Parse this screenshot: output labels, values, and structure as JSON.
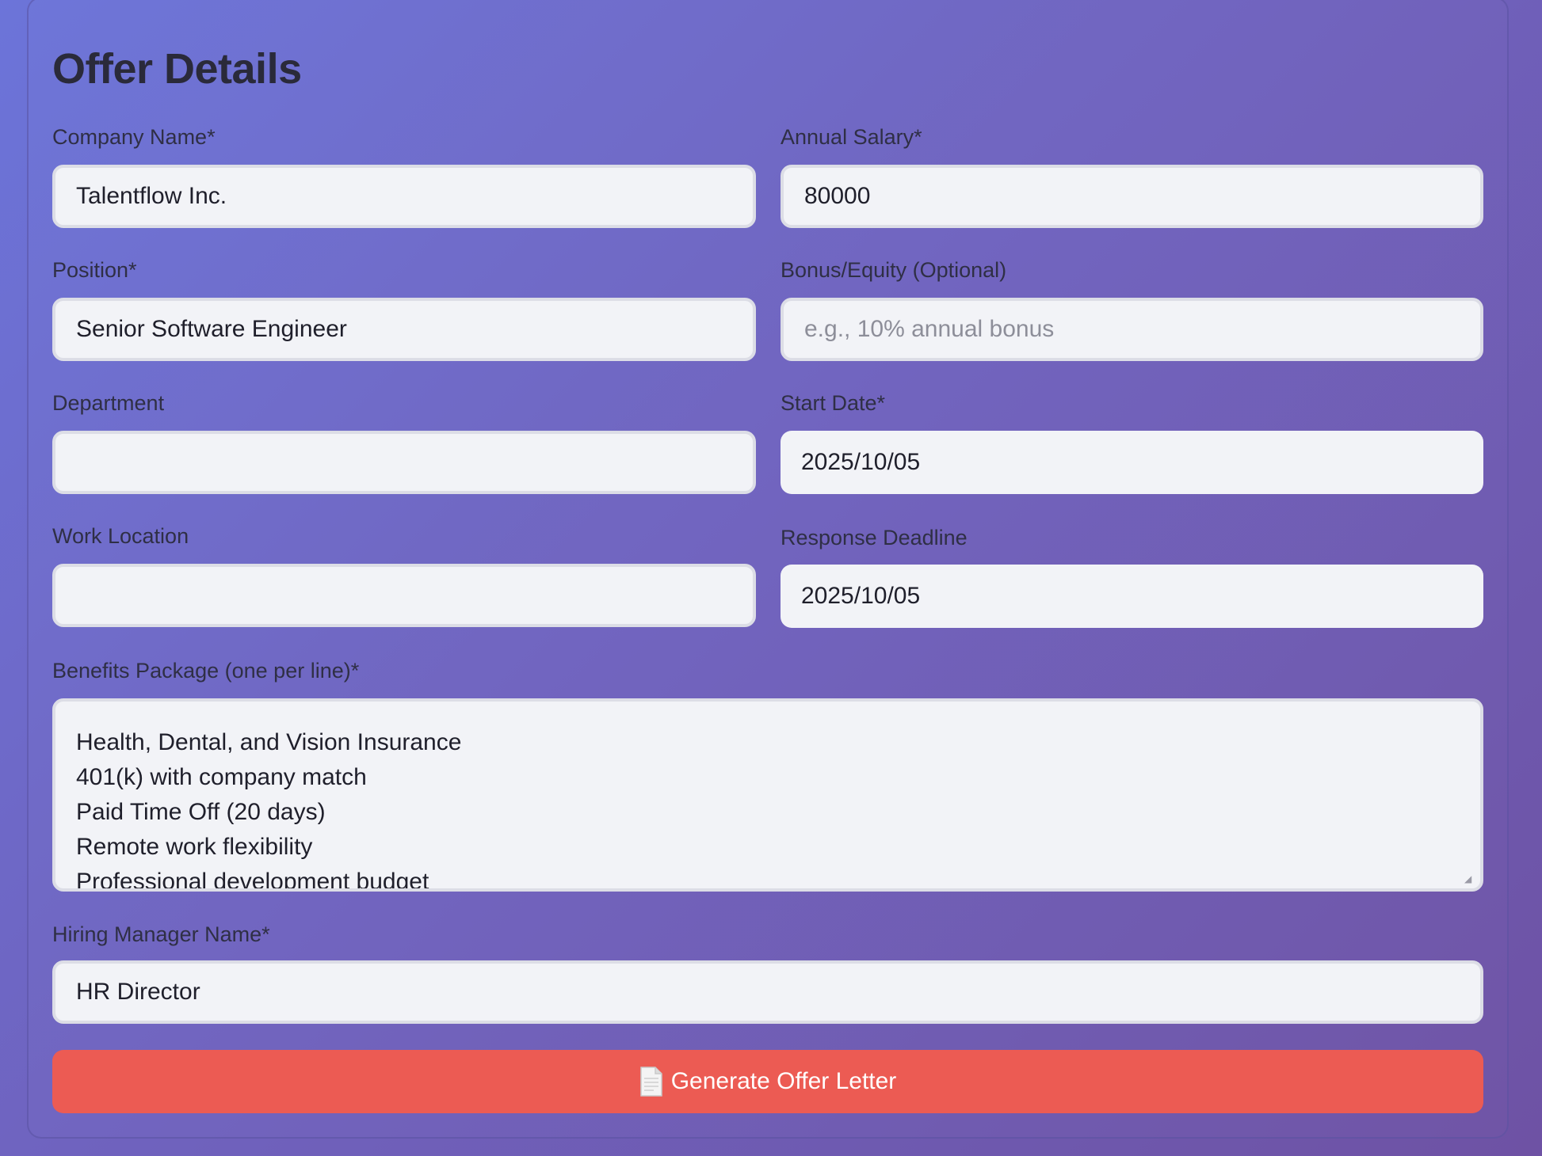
{
  "form": {
    "title": "Offer Details",
    "company": {
      "label": "Company Name*",
      "value": "Talentflow Inc."
    },
    "salary": {
      "label": "Annual Salary*",
      "value": "80000"
    },
    "position": {
      "label": "Position*",
      "value": "Senior Software Engineer"
    },
    "bonus": {
      "label": "Bonus/Equity (Optional)",
      "value": "",
      "placeholder": "e.g., 10% annual bonus"
    },
    "department": {
      "label": "Department",
      "value": ""
    },
    "start_date": {
      "label": "Start Date*",
      "value": "2025/10/05"
    },
    "work_location": {
      "label": "Work Location",
      "value": ""
    },
    "response_deadline": {
      "label": "Response Deadline",
      "value": "2025/10/05"
    },
    "benefits": {
      "label": "Benefits Package (one per line)*",
      "lines": [
        "Health, Dental, and Vision Insurance",
        "401(k) with company match",
        "Paid Time Off (20 days)",
        "Remote work flexibility",
        "Professional development budget"
      ]
    },
    "hiring_manager": {
      "label": "Hiring Manager Name*",
      "value": "HR Director"
    },
    "submit": {
      "label": "Generate Offer Letter",
      "icon": "document-icon"
    }
  },
  "colors": {
    "background_start": "#6c74d9",
    "background_end": "#6e52a4",
    "input_bg": "#f2f3f7",
    "button_bg": "#ec5b53"
  }
}
